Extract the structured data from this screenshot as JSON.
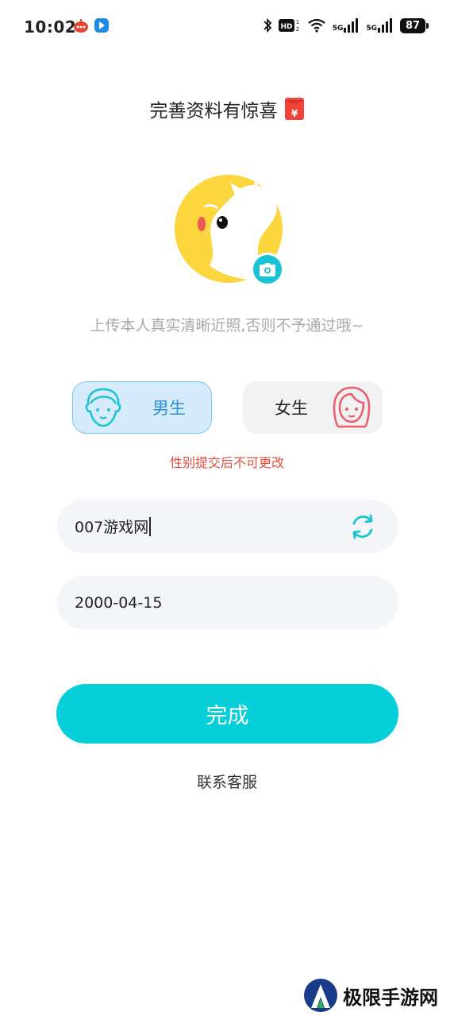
{
  "status_bar": {
    "time": "10:02",
    "network_1": "5G",
    "network_2": "5G",
    "battery": "87",
    "icons": [
      "app-notification-icon",
      "app-blue-icon",
      "bluetooth-icon",
      "hd-icon",
      "wifi-icon",
      "signal-icon",
      "signal-icon",
      "battery-icon"
    ]
  },
  "header": {
    "title": "完善资料有惊喜",
    "title_icon": "red-envelope-icon"
  },
  "avatar": {
    "icon": "squirrel-avatar-icon",
    "camera_icon": "camera-icon"
  },
  "hint": "上传本人真实清晰近照,否则不予通过哦~",
  "gender": {
    "male_label": "男生",
    "female_label": "女生",
    "selected": "male",
    "warning": "性别提交后不可更改"
  },
  "form": {
    "nickname_value": "007游戏网",
    "birthday_value": "2000-04-15"
  },
  "submit_label": "完成",
  "contact_label": "联系客服",
  "watermark": "极限手游网",
  "colors": {
    "accent": "#05cfd9",
    "male_bg": "#d6ecfc",
    "male_text": "#2a8fdc",
    "warning": "#e84b3c",
    "female_icon": "#f05a6a",
    "avatar_yellow": "#fbd63c"
  }
}
